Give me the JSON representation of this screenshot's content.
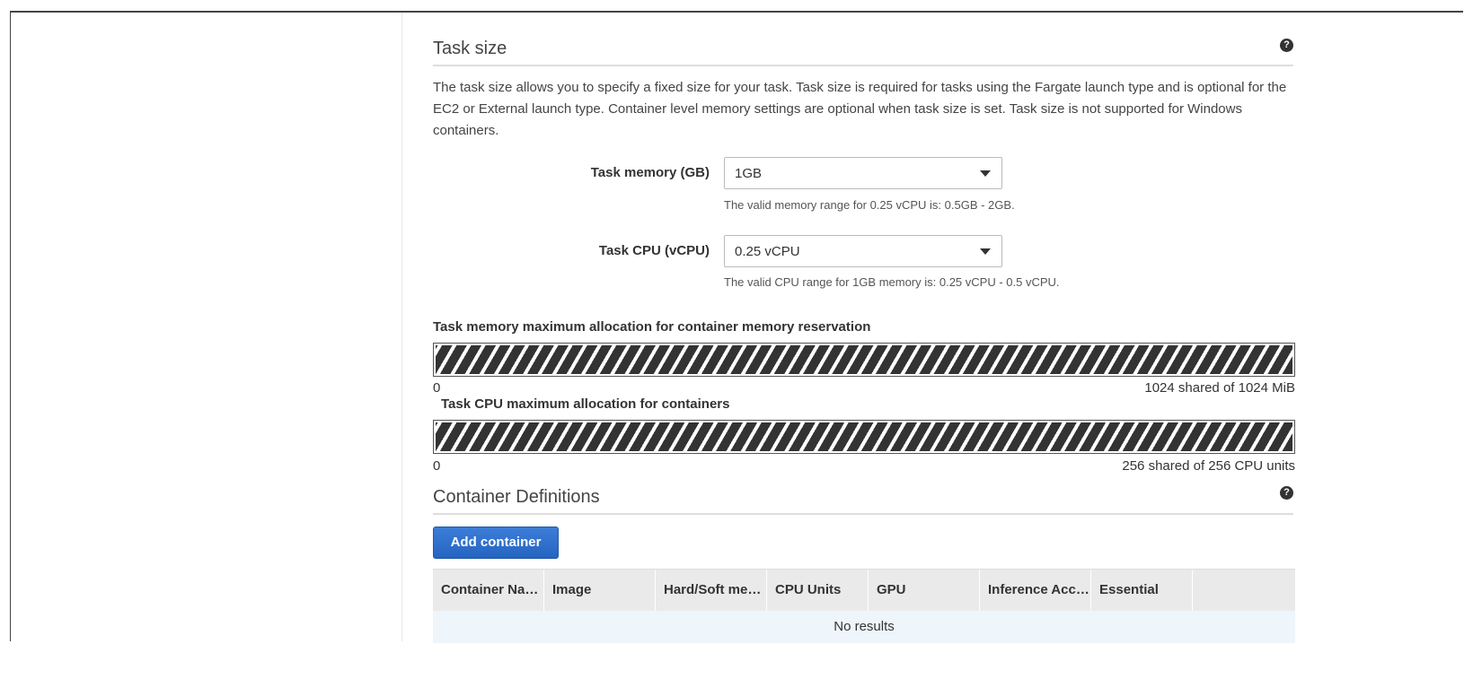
{
  "task_size": {
    "title": "Task size",
    "help_icon": "question-circle-icon",
    "description": "The task size allows you to specify a fixed size for your task. Task size is required for tasks using the Fargate launch type and is optional for the EC2 or External launch type. Container level memory settings are optional when task size is set. Task size is not supported for Windows containers.",
    "memory": {
      "label": "Task memory (GB)",
      "value": "1GB",
      "hint": "The valid memory range for 0.25 vCPU is: 0.5GB - 2GB."
    },
    "cpu": {
      "label": "Task CPU (vCPU)",
      "value": "0.25 vCPU",
      "hint": "The valid CPU range for 1GB memory is: 0.25 vCPU - 0.5 vCPU."
    }
  },
  "memory_allocation": {
    "label": "Task memory maximum allocation for container memory reservation",
    "min": "0",
    "max": "1024 shared of 1024 MiB",
    "fraction": 1.0
  },
  "cpu_allocation": {
    "label": "Task CPU maximum allocation for containers",
    "min": "0",
    "max": "256 shared of 256 CPU units",
    "fraction": 1.0
  },
  "container_definitions": {
    "title": "Container Definitions",
    "help_icon": "question-circle-icon",
    "add_button": "Add container",
    "columns": [
      "Container Name",
      "Image",
      "Hard/Soft memory limits",
      "CPU Units",
      "GPU",
      "Inference Accelerators",
      "Essential",
      ""
    ],
    "empty_text": "No results"
  },
  "colors": {
    "primary_button": "#2565c1",
    "table_header": "#eaeaea",
    "empty_row": "#eef5fb"
  }
}
